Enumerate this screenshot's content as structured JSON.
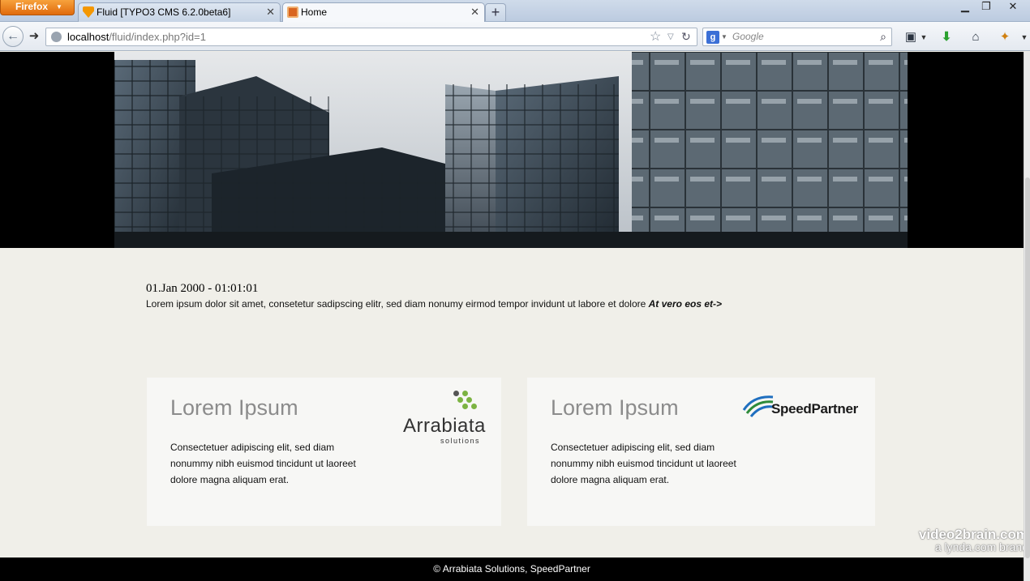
{
  "browser": {
    "menu_button": "Firefox",
    "tabs": [
      {
        "label": "Fluid [TYPO3 CMS 6.2.0beta6]"
      },
      {
        "label": "Home"
      }
    ],
    "new_tab": "+",
    "url_host": "localhost",
    "url_path": "/fluid/index.php?id=1",
    "search_placeholder": "Google"
  },
  "news": {
    "date": "01.Jan 2000 - 01:01:01",
    "teaser": "Lorem ipsum dolor sit amet, consetetur sadipscing elitr, sed diam nonumy eirmod tempor invidunt ut labore et dolore ",
    "more_link": "At vero eos et->"
  },
  "cards": [
    {
      "title": "Lorem Ipsum",
      "body": "Consectetuer adipiscing elit, sed diam nonummy nibh euismod tincidunt ut laoreet dolore magna aliquam erat.",
      "logo_text": "Arrabiata",
      "logo_sub": "solutions"
    },
    {
      "title": "Lorem Ipsum",
      "body": "Consectetuer adipiscing elit, sed diam nonummy nibh euismod tincidunt ut laoreet dolore magna aliquam erat.",
      "logo_text": "SpeedPartner"
    }
  ],
  "footer": {
    "text": "© Arrabiata Solutions, SpeedPartner"
  },
  "watermark": {
    "line1": "video2brain.com",
    "line2": "a lynda.com brand"
  },
  "colors": {
    "page_background": "#f0efe9",
    "card_title": "#8c8c8c",
    "footer_background": "#000000",
    "arrabiata_green": "#7cb342"
  }
}
